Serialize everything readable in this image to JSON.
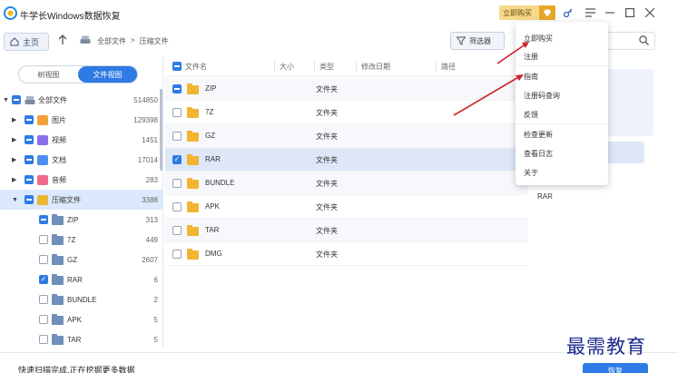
{
  "app": {
    "title": "牛学长Windows数据恢复",
    "buy_label": "立即购买"
  },
  "icons": {
    "logo": "app-logo-icon",
    "gem": "diamond-icon",
    "key": "key-icon",
    "menu": "hamburger-menu-icon",
    "min": "minimize-icon",
    "max": "maximize-icon",
    "close": "close-icon"
  },
  "navbar": {
    "home_label": "主页",
    "breadcrumb": [
      "全部文件",
      "压缩文件"
    ],
    "filter_label": "筛选器",
    "search": {
      "value": "",
      "placeholder": ""
    }
  },
  "sidebar": {
    "tabs": [
      "树视图",
      "文件视图"
    ],
    "active_tab": "文件视图",
    "tree": [
      {
        "label": "全部文件",
        "count": "514850",
        "check": "partial",
        "expanded": true
      },
      {
        "label": "图片",
        "count": "129398",
        "check": "partial",
        "color": "#f2a23a"
      },
      {
        "label": "视频",
        "count": "1451",
        "check": "partial",
        "color": "#8a6ee8"
      },
      {
        "label": "文档",
        "count": "17014",
        "check": "partial",
        "color": "#4a8ef0"
      },
      {
        "label": "音频",
        "count": "283",
        "check": "partial",
        "color": "#ef6a8a"
      },
      {
        "label": "压缩文件",
        "count": "3388",
        "check": "partial",
        "color": "#e9b733",
        "expanded": true,
        "selected": true
      },
      {
        "label": "ZIP",
        "count": "313",
        "check": "partial"
      },
      {
        "label": "7Z",
        "count": "449",
        "check": "none"
      },
      {
        "label": "GZ",
        "count": "2607",
        "check": "none"
      },
      {
        "label": "RAR",
        "count": "6",
        "check": "checked"
      },
      {
        "label": "BUNDLE",
        "count": "2",
        "check": "none"
      },
      {
        "label": "APK",
        "count": "5",
        "check": "none"
      },
      {
        "label": "TAR",
        "count": "5",
        "check": "none"
      }
    ]
  },
  "file_list": {
    "columns": [
      "文件名",
      "大小",
      "类型",
      "修改日期",
      "路径"
    ],
    "rows": [
      {
        "name": "ZIP",
        "type": "文件夹",
        "check": "partial"
      },
      {
        "name": "7Z",
        "type": "文件夹",
        "check": "none"
      },
      {
        "name": "GZ",
        "type": "文件夹",
        "check": "none"
      },
      {
        "name": "RAR",
        "type": "文件夹",
        "check": "checked",
        "selected": true
      },
      {
        "name": "BUNDLE",
        "type": "文件夹",
        "check": "none"
      },
      {
        "name": "APK",
        "type": "文件夹",
        "check": "none"
      },
      {
        "name": "TAR",
        "type": "文件夹",
        "check": "none"
      },
      {
        "name": "DMG",
        "type": "文件夹",
        "check": "none"
      }
    ]
  },
  "right_panel": {
    "item": "RAR"
  },
  "menu": {
    "items": [
      "立即购买",
      "注册",
      "指南",
      "注册码查询",
      "反馈",
      "检查更新",
      "查看日志",
      "关于"
    ]
  },
  "bottom": {
    "status": "快速扫描完成,正在挖掘更多数据",
    "recover_label": "恢复"
  },
  "watermark": "最需教育",
  "colors": {
    "accent": "#2e7be5",
    "arrow": "#d0202a",
    "folder": "#f1b533"
  }
}
